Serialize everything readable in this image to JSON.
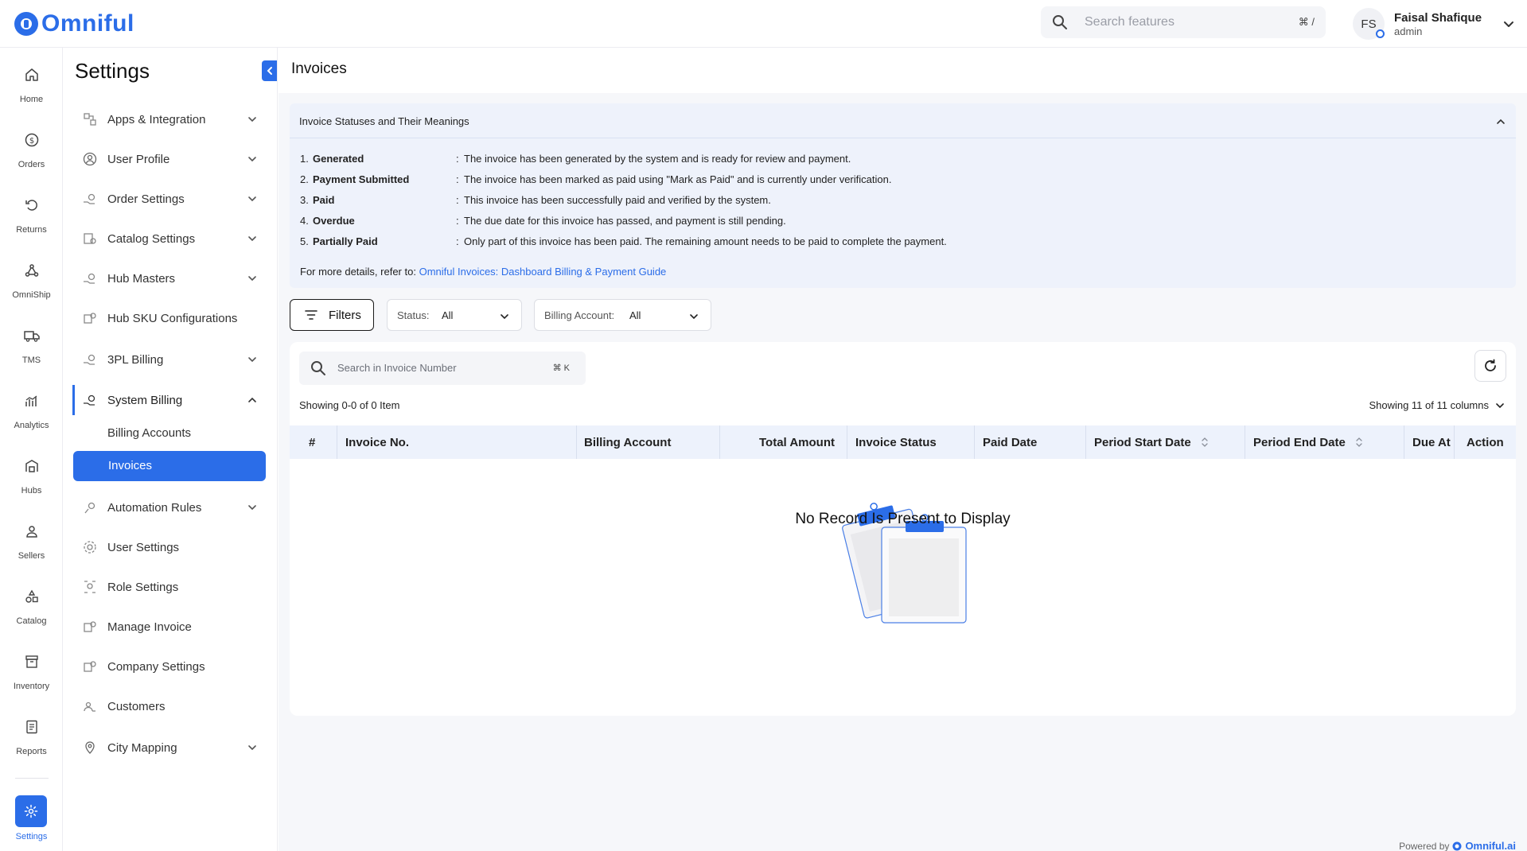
{
  "brand": {
    "name": "Omniful",
    "color": "#2b6de8"
  },
  "topbar": {
    "search_placeholder": "Search features",
    "search_shortcut": "⌘ /",
    "user": {
      "initials": "FS",
      "name": "Faisal Shafique",
      "role": "admin"
    }
  },
  "rail": {
    "items": [
      {
        "label": "Home",
        "icon": "home-icon"
      },
      {
        "label": "Orders",
        "icon": "dollar-icon"
      },
      {
        "label": "Returns",
        "icon": "return-icon"
      },
      {
        "label": "OmniShip",
        "icon": "network-icon"
      },
      {
        "label": "TMS",
        "icon": "truck-icon"
      },
      {
        "label": "Analytics",
        "icon": "analytics-icon"
      },
      {
        "label": "Hubs",
        "icon": "warehouse-icon"
      },
      {
        "label": "Sellers",
        "icon": "person-icon"
      },
      {
        "label": "Catalog",
        "icon": "shapes-icon"
      },
      {
        "label": "Inventory",
        "icon": "box-icon"
      },
      {
        "label": "Reports",
        "icon": "report-icon"
      }
    ],
    "active": {
      "label": "Settings",
      "icon": "gear-icon"
    }
  },
  "settings": {
    "title": "Settings",
    "items": [
      {
        "label": "Apps & Integration",
        "expandable": true
      },
      {
        "label": "User Profile",
        "expandable": true
      },
      {
        "label": "Order Settings",
        "expandable": true
      },
      {
        "label": "Catalog Settings",
        "expandable": true
      },
      {
        "label": "Hub Masters",
        "expandable": true
      },
      {
        "label": "Hub SKU Configurations",
        "expandable": false
      },
      {
        "label": "3PL Billing",
        "expandable": true
      },
      {
        "label": "System Billing",
        "expandable": true,
        "open": true
      },
      {
        "label": "Automation Rules",
        "expandable": true
      },
      {
        "label": "User Settings",
        "expandable": false
      },
      {
        "label": "Role Settings",
        "expandable": false
      },
      {
        "label": "Manage Invoice",
        "expandable": false
      },
      {
        "label": "Company Settings",
        "expandable": false
      },
      {
        "label": "Customers",
        "expandable": false
      },
      {
        "label": "City Mapping",
        "expandable": true
      }
    ],
    "sub_items": [
      "Billing Accounts",
      "Invoices"
    ],
    "active_sub": "Invoices"
  },
  "main": {
    "title": "Invoices",
    "info": {
      "heading": "Invoice Statuses and Their Meanings",
      "rows": [
        {
          "num": "1.",
          "term": "Generated",
          "desc": "The invoice has been generated by the system and is ready for review and payment."
        },
        {
          "num": "2.",
          "term": "Payment Submitted",
          "desc": "The invoice has been marked as paid using \"Mark as Paid\" and is currently under verification."
        },
        {
          "num": "3.",
          "term": "Paid",
          "desc": "This invoice has been successfully paid and verified by the system."
        },
        {
          "num": "4.",
          "term": "Overdue",
          "desc": "The due date for this invoice has passed, and payment is still pending."
        },
        {
          "num": "5.",
          "term": "Partially Paid",
          "desc": "Only part of this invoice has been paid. The remaining amount needs to be paid to complete the payment."
        }
      ],
      "more_prefix": "For more details, refer to:",
      "more_link": "Omniful Invoices: Dashboard Billing & Payment Guide"
    },
    "filters": {
      "button": "Filters",
      "status_label": "Status:",
      "status_value": "All",
      "billing_label": "Billing Account:",
      "billing_value": "All"
    },
    "table": {
      "search_placeholder": "Search in Invoice Number",
      "search_shortcut": "⌘ K",
      "showing": "Showing 0-0 of 0 Item",
      "columns_info": "Showing 11 of 11 columns",
      "columns": [
        "#",
        "Invoice No.",
        "Billing Account",
        "Total Amount",
        "Invoice Status",
        "Paid Date",
        "Period Start Date",
        "Period End Date",
        "Due At",
        "Action"
      ],
      "empty_text": "No Record Is Present to Display"
    },
    "powered_by": "Powered by",
    "powered_brand": "Omniful.ai"
  }
}
